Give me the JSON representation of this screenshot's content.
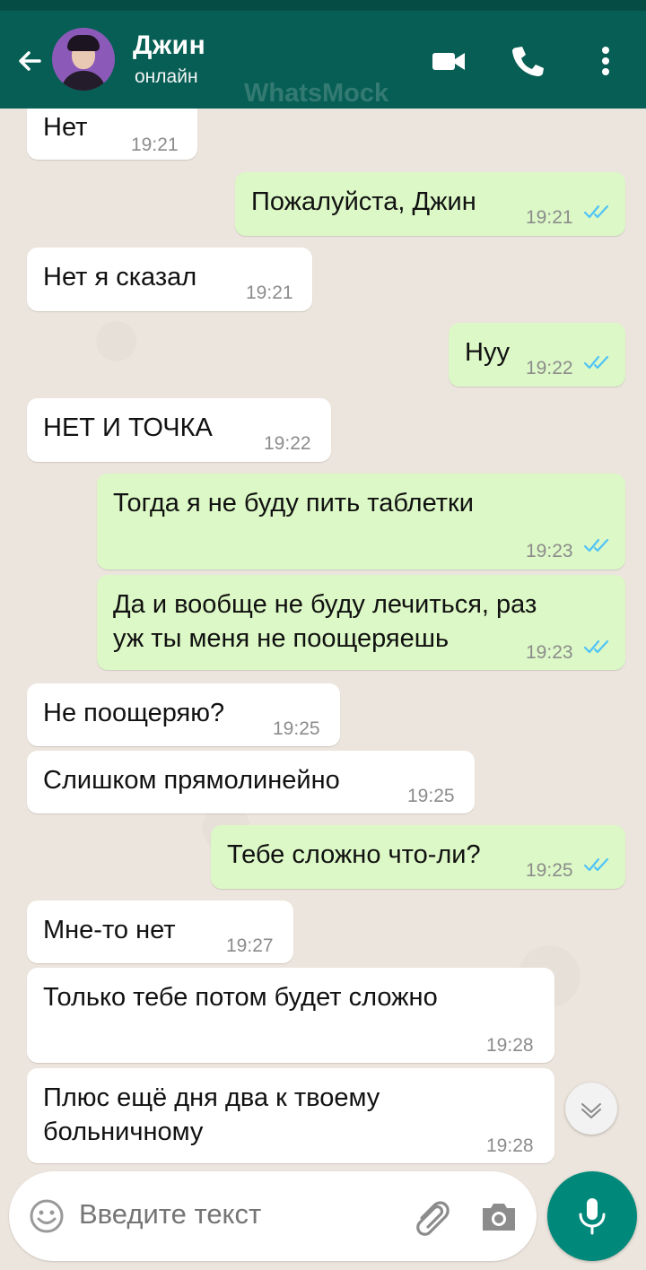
{
  "header": {
    "name": "Джин",
    "status": "онлайн",
    "watermark": "WhatsMock",
    "icons": [
      "back-arrow-icon",
      "video-icon",
      "call-icon",
      "more-vert-icon"
    ]
  },
  "colors": {
    "header": "#075e54",
    "incoming": "#ffffff",
    "outgoing": "#dcf8c6",
    "read_ticks": "#4fc3f7",
    "mic": "#00897b"
  },
  "messages": [
    {
      "dir": "in",
      "text": "Нет",
      "time": "19:21"
    },
    {
      "dir": "out",
      "text": "Пожалуйста, Джин",
      "time": "19:21",
      "read": true
    },
    {
      "dir": "in",
      "text": "Нет я сказал",
      "time": "19:21"
    },
    {
      "dir": "out",
      "text": "Нуу",
      "time": "19:22",
      "read": true
    },
    {
      "dir": "in",
      "text": "НЕТ И ТОЧКА",
      "time": "19:22"
    },
    {
      "dir": "out",
      "text": "Тогда я не буду пить таблетки",
      "time": "19:23",
      "read": true
    },
    {
      "dir": "out",
      "text": "Да и вообще не буду лечиться, раз\nуж ты меня не поощеряешь",
      "time": "19:23",
      "read": true
    },
    {
      "dir": "in",
      "text": "Не поощеряю?",
      "time": "19:25"
    },
    {
      "dir": "in",
      "text": "Слишком прямолинейно",
      "time": "19:25"
    },
    {
      "dir": "out",
      "text": "Тебе сложно что-ли?",
      "time": "19:25",
      "read": true
    },
    {
      "dir": "in",
      "text": "Мне-то нет",
      "time": "19:27"
    },
    {
      "dir": "in",
      "text": "Только тебе потом будет сложно",
      "time": "19:28"
    },
    {
      "dir": "in",
      "text": "Плюс ещё дня два к твоему\nбольничному",
      "time": "19:28"
    }
  ],
  "composer": {
    "placeholder": "Введите текст",
    "icons": [
      "emoji-icon",
      "attach-icon",
      "camera-icon",
      "mic-icon"
    ]
  }
}
